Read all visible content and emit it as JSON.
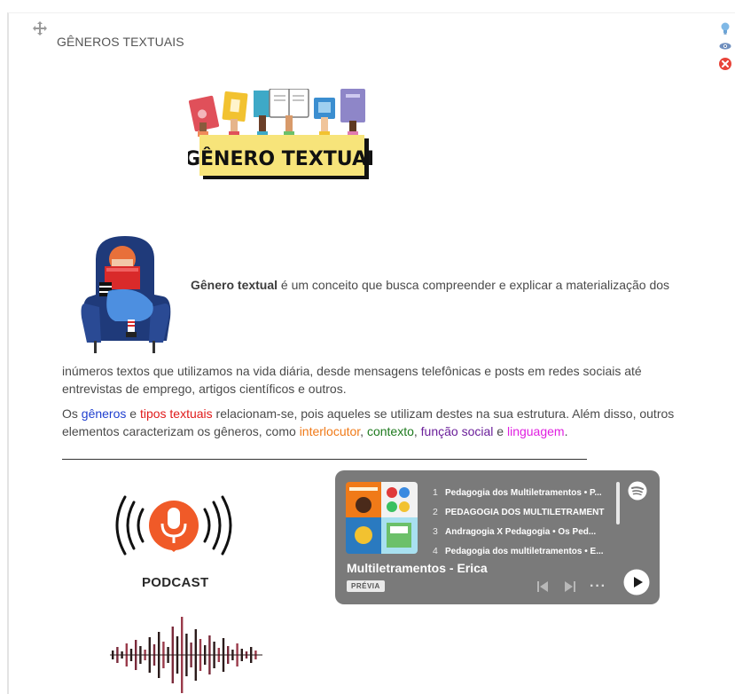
{
  "section": {
    "title": "GÊNEROS TEXTUAIS"
  },
  "icons": {
    "move": "move-arrows-icon",
    "hint": "lightbulb-icon",
    "visibility": "eye-icon",
    "delete": "close-circle-icon"
  },
  "banner": {
    "text": "GÊNERO TEXTUAL"
  },
  "content": {
    "intro_bold": "Gênero textual",
    "intro_rest": " é um conceito que busca compreender e explicar a materialização dos",
    "para1_a": "inúmeros ",
    "para1_textos": "textos",
    "para1_b": " que utilizamos na vida diária, desde mensagens telefônicas e posts em redes sociais até",
    "para1_c": "entrevistas de emprego, artigos científicos e outros.",
    "para2_a": "Os ",
    "para2_generos": "gêneros",
    "para2_b": " e ",
    "para2_tipos": "tipos textuais",
    "para2_c": " relacionam-se, pois aqueles se utilizam destes na sua estrutura. Além disso, outros",
    "para2_d": "elementos caracterizam os gêneros, como ",
    "para2_interlocutor": "interlocutor",
    "para2_sep1": ", ",
    "para2_contexto": "contexto",
    "para2_sep2": ", ",
    "para2_funcao": "função social",
    "para2_e": " e ",
    "para2_linguagem": "linguagem",
    "para2_end": "."
  },
  "podcast": {
    "label": "PODCAST"
  },
  "spotify": {
    "tracks": [
      {
        "num": "1",
        "title": "Pedagogia dos Multiletramentos • P..."
      },
      {
        "num": "2",
        "title": "PEDAGOGIA DOS MULTILETRAMENT"
      },
      {
        "num": "3",
        "title": "Andragogia X Pedagogia • Os Ped..."
      },
      {
        "num": "4",
        "title": "Pedagogia dos multiletramentos • E..."
      }
    ],
    "show_title": "Multiletramentos - Erica",
    "badge": "PRÉVIA",
    "more": "···"
  },
  "colors": {
    "blue": "#1f3fcf",
    "red": "#e01b1b",
    "orange": "#f07a18",
    "green": "#1e7a1e",
    "purple": "#6b1f9a",
    "magenta": "#e020e0",
    "spotify_bg": "#7a7a7a",
    "podcast_orange": "#f05a28"
  }
}
